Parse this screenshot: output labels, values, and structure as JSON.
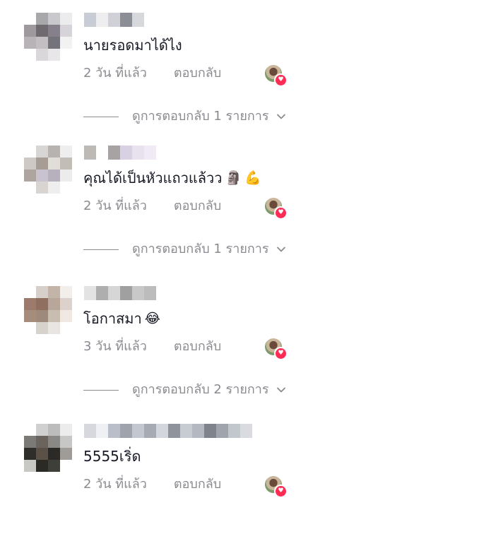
{
  "comments": [
    {
      "text": "นายรอดมาได้ไง",
      "emoji": [],
      "time": "2 วัน ที่แล้ว",
      "reply_label": "ตอบกลับ",
      "view_replies": "ดูการตอบกลับ 1 รายการ",
      "avatar_colors": [
        "#ffffff",
        "#a8a8aa",
        "#c9c8cc",
        "#ececee",
        "#9e999c",
        "#6f6a70",
        "#85808a",
        "#d6d4d8",
        "#b8b3b6",
        "#c2bec2",
        "#74727a",
        "#f2f2f3",
        "#ffffff",
        "#d9d7d9",
        "#e8e6e8",
        "#ffffff"
      ],
      "username_colors": [
        "#c8ccd4",
        "#eeeef0",
        "#cfd1d6",
        "#8c8e95",
        "#d7d8dc"
      ]
    },
    {
      "text": "คุณได้เป็นหัวแถวแล้วว",
      "emoji": [
        "🗿",
        "💪"
      ],
      "time": "2 วัน ที่แล้ว",
      "reply_label": "ตอบกลับ",
      "view_replies": "ดูการตอบกลับ 1 รายการ",
      "avatar_colors": [
        "#ffffff",
        "#d8d6d4",
        "#b7b3b0",
        "#efeeee",
        "#cfc9c6",
        "#a79c96",
        "#e1ddd9",
        "#c3bdb8",
        "#aea4a0",
        "#c9c3cf",
        "#b7b1bd",
        "#ececec",
        "#ffffff",
        "#d7d4d2",
        "#eeeeee",
        "#ffffff"
      ],
      "username_colors": [
        "#bdb9b5",
        "#ffffff",
        "#a6a3a2",
        "#d8d0e3",
        "#e7e2ee",
        "#efeaf4"
      ]
    },
    {
      "text": "โอกาสมา",
      "emoji": [
        "😂"
      ],
      "time": "3 วัน ที่แล้ว",
      "reply_label": "ตอบกลับ",
      "view_replies": "ดูการตอบกลับ 2 รายการ",
      "avatar_colors": [
        "#ffffff",
        "#d7cfca",
        "#c3b4a9",
        "#f2eeea",
        "#9c7b6c",
        "#8f6f60",
        "#b7a699",
        "#dcd2cb",
        "#a58c7d",
        "#9e8a7c",
        "#c9bcb0",
        "#efe8e3",
        "#ffffff",
        "#d8d2cd",
        "#e9e5e2",
        "#ffffff"
      ],
      "username_colors": [
        "#e3e3e3",
        "#aeaeae",
        "#d6d6d6",
        "#a0a0a0",
        "#c8c8c8",
        "#bcbcbc"
      ]
    },
    {
      "text": "5555เริ่ด",
      "emoji": [],
      "time": "2 วัน ที่แล้ว",
      "reply_label": "ตอบกลับ",
      "view_replies": "",
      "avatar_colors": [
        "#ffffff",
        "#d0d0d0",
        "#bcbcbc",
        "#ececec",
        "#7b7a76",
        "#6b645e",
        "#8a8884",
        "#c7c7c5",
        "#2f2e2b",
        "#5b5147",
        "#2c2a27",
        "#9f9c97",
        "#c8c8c4",
        "#2b2a25",
        "#3e3f38",
        "#ffffff"
      ],
      "username_colors": [
        "#d6d8de",
        "#eef0f3",
        "#b9bec8",
        "#9ea3ac",
        "#c3c7cf",
        "#a6aab3",
        "#d3d6dc",
        "#8f939c",
        "#c7cbd2",
        "#b4b8c1",
        "#7f838c",
        "#a0a4ad",
        "#c2c6cd",
        "#d9dbe1"
      ]
    }
  ],
  "liker_avatar": "liker-avatar",
  "colors": {
    "text": "#161823",
    "secondary": "#8a8b91",
    "heart": "#fe2c55"
  }
}
